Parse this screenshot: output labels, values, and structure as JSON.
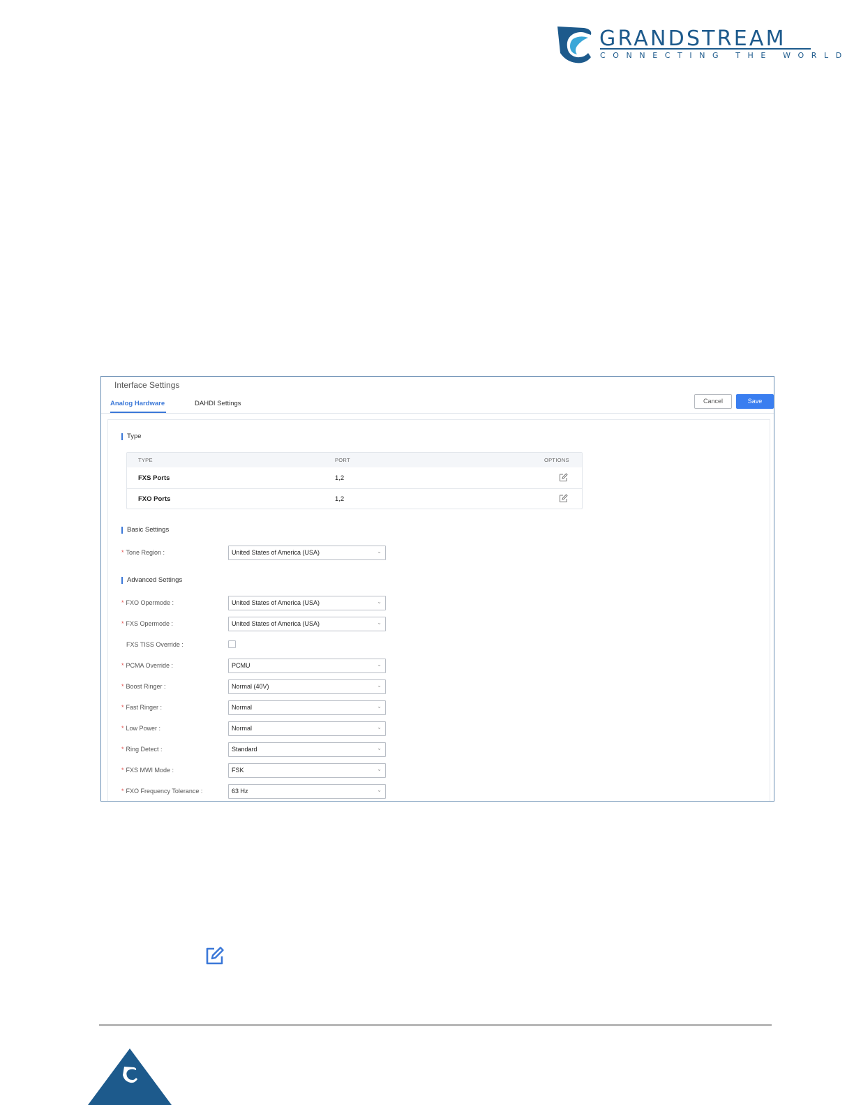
{
  "logo": {
    "brand": "GRANDSTREAM",
    "tagline": "CONNECTING THE WORLD",
    "color": "#1d5a8c"
  },
  "panel": {
    "title": "Interface Settings",
    "tabs": [
      {
        "label": "Analog Hardware",
        "active": true
      },
      {
        "label": "DAHDI Settings",
        "active": false
      }
    ],
    "buttons": {
      "cancel": "Cancel",
      "save": "Save"
    },
    "accent": "#3b78d8"
  },
  "type_section": {
    "heading": "Type",
    "columns": [
      "TYPE",
      "PORT",
      "OPTIONS"
    ],
    "rows": [
      {
        "type": "FXS Ports",
        "port": "1,2",
        "option_icon": "edit-icon"
      },
      {
        "type": "FXO Ports",
        "port": "1,2",
        "option_icon": "edit-icon"
      }
    ]
  },
  "basic_settings": {
    "heading": "Basic Settings",
    "tone_region": {
      "label": "Tone Region :",
      "value": "United States of America (USA)"
    }
  },
  "advanced_settings": {
    "heading": "Advanced Settings",
    "fxo_opermode": {
      "label": "FXO Opermode :",
      "value": "United States of America (USA)"
    },
    "fxs_opermode": {
      "label": "FXS Opermode :",
      "value": "United States of America (USA)"
    },
    "fxs_tiss_override": {
      "label": "FXS TISS Override :",
      "checked": false
    },
    "pcma_override": {
      "label": "PCMA Override :",
      "value": "PCMU"
    },
    "boost_ringer": {
      "label": "Boost Ringer :",
      "value": "Normal (40V)"
    },
    "fast_ringer": {
      "label": "Fast Ringer :",
      "value": "Normal"
    },
    "low_power": {
      "label": "Low Power :",
      "value": "Normal"
    },
    "ring_detect": {
      "label": "Ring Detect :",
      "value": "Standard"
    },
    "fxs_mwi_mode": {
      "label": "FXS MWI Mode :",
      "value": "FSK"
    },
    "fxo_frequency_tolerance": {
      "label": "FXO Frequency Tolerance :",
      "value": "63 Hz"
    }
  },
  "required_marker": "*",
  "select_arrow": "⌄",
  "colors": {
    "save_button": "#3a7ef0",
    "required": "#e0514f",
    "frame_border": "#6b8fb4"
  }
}
